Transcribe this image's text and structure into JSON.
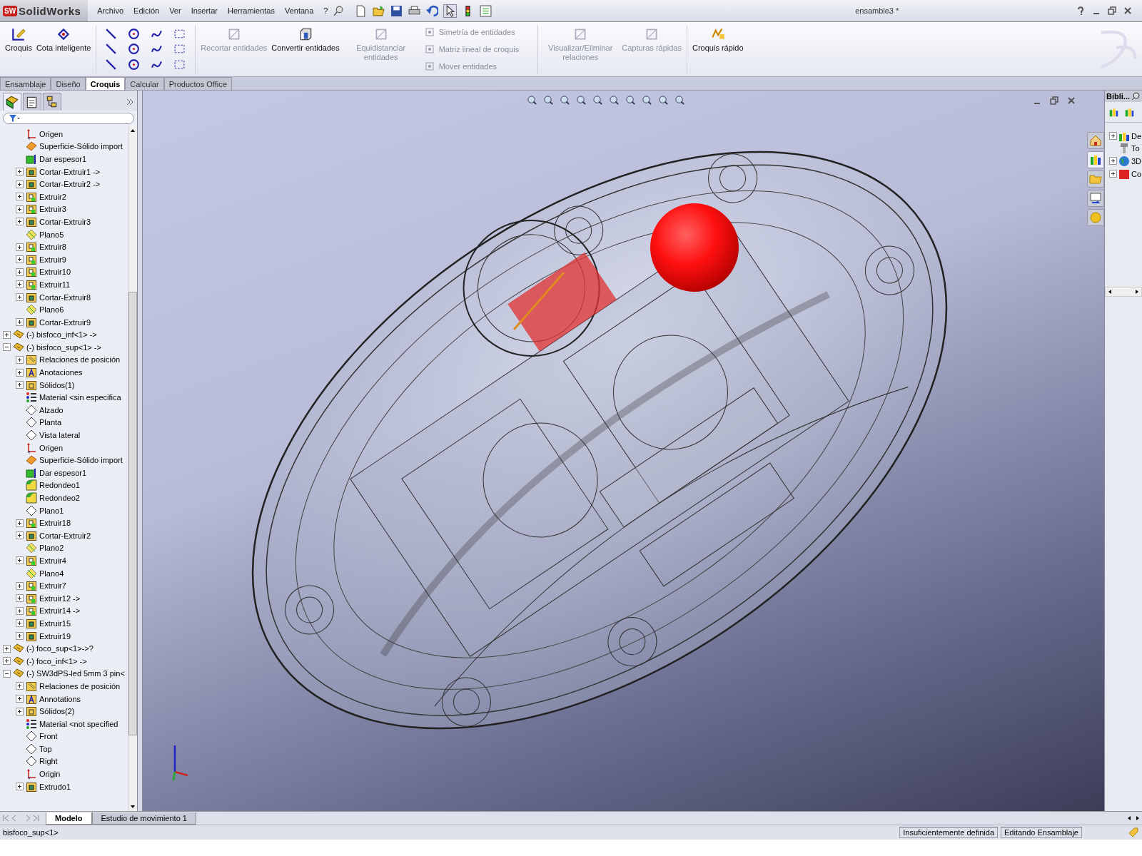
{
  "app": {
    "badge": "SW",
    "name": "SolidWorks"
  },
  "menu": [
    "Archivo",
    "Edición",
    "Ver",
    "Insertar",
    "Herramientas",
    "Ventana",
    "?"
  ],
  "window": {
    "title": "ensamble3 *"
  },
  "ribbon": [
    {
      "kind": "large",
      "label": "Croquis",
      "disabled": false
    },
    {
      "kind": "large",
      "label": "Cota inteligente",
      "disabled": false
    },
    {
      "kind": "tools"
    },
    {
      "kind": "large",
      "label": "Recortar entidades",
      "disabled": true
    },
    {
      "kind": "large",
      "label": "Convertir entidades",
      "disabled": false
    },
    {
      "kind": "large",
      "label": "Equidistanciar entidades",
      "disabled": true
    },
    {
      "kind": "stack",
      "items": [
        {
          "label": "Simetría de entidades",
          "disabled": true
        },
        {
          "label": "Matriz lineal de croquis",
          "disabled": true
        },
        {
          "label": "Mover entidades",
          "disabled": true
        }
      ]
    },
    {
      "kind": "large",
      "label": "Visualizar/Eliminar relaciones",
      "disabled": true
    },
    {
      "kind": "large",
      "label": "Capturas rápidas",
      "disabled": true
    },
    {
      "kind": "large",
      "label": "Croquis rápido",
      "disabled": false
    }
  ],
  "tabs": [
    {
      "label": "Ensamblaje",
      "selected": false
    },
    {
      "label": "Diseño",
      "selected": false
    },
    {
      "label": "Croquis",
      "selected": true
    },
    {
      "label": "Calcular",
      "selected": false
    },
    {
      "label": "Productos Office",
      "selected": false
    }
  ],
  "tree": {
    "continued": [
      {
        "label": "Origen",
        "kind": "origin"
      },
      {
        "label": "Superficie-Sólido import",
        "kind": "surface"
      },
      {
        "label": "Dar espesor1",
        "kind": "thicken"
      },
      {
        "label": "Cortar-Extruir1 ->",
        "kind": "cut",
        "expanded": false
      },
      {
        "label": "Cortar-Extruir2 ->",
        "kind": "cut",
        "expanded": false
      },
      {
        "label": "Extruir2",
        "kind": "extrude",
        "expanded": false
      },
      {
        "label": "Extruir3",
        "kind": "extrude",
        "expanded": false
      },
      {
        "label": "Cortar-Extruir3",
        "kind": "cut",
        "expanded": false
      },
      {
        "label": "Plano5",
        "kind": "plane"
      },
      {
        "label": "Extruir8",
        "kind": "extrude",
        "expanded": false
      },
      {
        "label": "Extruir9",
        "kind": "extrude",
        "expanded": false
      },
      {
        "label": "Extruir10",
        "kind": "extrude",
        "expanded": false
      },
      {
        "label": "Extruir11",
        "kind": "extrude",
        "expanded": false
      },
      {
        "label": "Cortar-Extruir8",
        "kind": "cut",
        "expanded": false
      },
      {
        "label": "Plano6",
        "kind": "plane"
      },
      {
        "label": "Cortar-Extruir9",
        "kind": "cut",
        "expanded": false
      }
    ],
    "items": [
      {
        "label": "(-) bisfoco_inf<1> ->",
        "kind": "component",
        "expanded": false
      },
      {
        "label": "(-) bisfoco_sup<1> ->",
        "kind": "component",
        "expanded": true,
        "children": [
          {
            "label": "Relaciones de posición",
            "kind": "mates",
            "expanded": false
          },
          {
            "label": "Anotaciones",
            "kind": "annotations",
            "expanded": false
          },
          {
            "label": "Sólidos(1)",
            "kind": "solids",
            "expanded": false
          },
          {
            "label": "Material <sin especifica",
            "kind": "material"
          },
          {
            "label": "Alzado",
            "kind": "refplane"
          },
          {
            "label": "Planta",
            "kind": "refplane"
          },
          {
            "label": "Vista lateral",
            "kind": "refplane"
          },
          {
            "label": "Origen",
            "kind": "origin"
          },
          {
            "label": "Superficie-Sólido import",
            "kind": "surface"
          },
          {
            "label": "Dar espesor1",
            "kind": "thicken"
          },
          {
            "label": "Redondeo1",
            "kind": "fillet"
          },
          {
            "label": "Redondeo2",
            "kind": "fillet"
          },
          {
            "label": "Plano1",
            "kind": "refplane"
          },
          {
            "label": "Extruir18",
            "kind": "extrude",
            "expanded": false
          },
          {
            "label": "Cortar-Extruir2",
            "kind": "cut",
            "expanded": false
          },
          {
            "label": "Plano2",
            "kind": "plane"
          },
          {
            "label": "Extruir4",
            "kind": "extrude",
            "expanded": false
          },
          {
            "label": "Plano4",
            "kind": "plane"
          },
          {
            "label": "Extruir7",
            "kind": "extrude",
            "expanded": false
          },
          {
            "label": "Extruir12 ->",
            "kind": "extrude",
            "expanded": false
          },
          {
            "label": "Extruir14 ->",
            "kind": "extrude",
            "expanded": false
          },
          {
            "label": "Extruir15",
            "kind": "cut",
            "expanded": false
          },
          {
            "label": "Extruir19",
            "kind": "cut",
            "expanded": false
          }
        ]
      },
      {
        "label": "(-) foco_sup<1>->?",
        "kind": "component",
        "expanded": false
      },
      {
        "label": "(-) foco_inf<1> ->",
        "kind": "component",
        "expanded": false
      },
      {
        "label": "(-) SW3dPS-led 5mm 3 pin<",
        "kind": "component",
        "expanded": true,
        "children": [
          {
            "label": "Relaciones de posición",
            "kind": "mates",
            "expanded": false
          },
          {
            "label": "Annotations",
            "kind": "annotations",
            "expanded": false
          },
          {
            "label": "Sólidos(2)",
            "kind": "solids",
            "expanded": false
          },
          {
            "label": "Material <not specified",
            "kind": "material"
          },
          {
            "label": "Front",
            "kind": "refplane"
          },
          {
            "label": "Top",
            "kind": "refplane"
          },
          {
            "label": "Right",
            "kind": "refplane"
          },
          {
            "label": "Origin",
            "kind": "origin"
          },
          {
            "label": "Extrudo1",
            "kind": "cut",
            "expanded": false
          }
        ]
      }
    ]
  },
  "library": {
    "title": "Bibli...",
    "items": [
      {
        "label": "De",
        "kind": "library",
        "expanded": false
      },
      {
        "label": "To",
        "kind": "bolt"
      },
      {
        "label": "3D",
        "kind": "globe",
        "expanded": false
      },
      {
        "label": "Co",
        "kind": "sw",
        "expanded": false
      }
    ]
  },
  "bottom_tabs": [
    {
      "label": "Modelo",
      "selected": true
    },
    {
      "label": "Estudio de movimiento 1",
      "selected": false
    }
  ],
  "status_bar": {
    "text": "bisfoco_sup<1>",
    "fields": [
      "Insuficientemente definida",
      "Editando Ensamblaje"
    ]
  }
}
